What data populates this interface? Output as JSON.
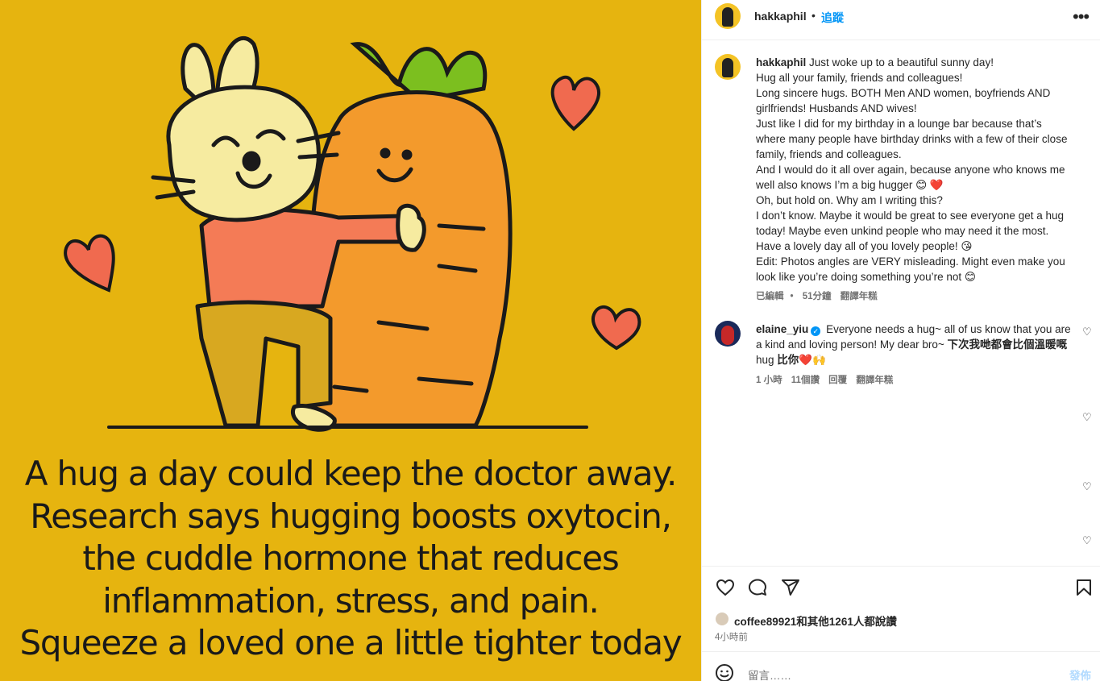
{
  "post_image": {
    "lines": [
      "A hug a day could keep the doctor away.",
      "Research says hugging boosts oxytocin,",
      "the cuddle hormone that reduces",
      "inflammation, stress, and pain.",
      "Squeeze a loved one a little tighter today"
    ],
    "background_color": "#e6b40f"
  },
  "header": {
    "username": "hakkaphil",
    "separator": "•",
    "follow_label": "追蹤",
    "more_icon": "more-horizontal-icon"
  },
  "caption": {
    "username": "hakkaphil",
    "lines": [
      "Just woke up to a beautiful sunny day!",
      "Hug all your family, friends and colleagues!",
      "Long sincere hugs. BOTH Men AND women, boyfriends AND",
      "girlfriends! Husbands AND wives!",
      "Just like I did for my birthday in a lounge bar because that’s",
      "where many people have birthday drinks with a few of their close",
      "family, friends and colleagues.",
      "And I would do it all over again, because anyone who knows me",
      "well also knows I’m a big hugger 😊 ❤️",
      "Oh, but hold on. Why am I writing this?",
      "I don’t know. Maybe it would be great to see everyone get a hug",
      "today! Maybe even unkind people who may need it the most.",
      "Have a lovely day all of you lovely people! 😘",
      "Edit: Photos angles are VERY misleading. Might even make you",
      "look like you’re doing something you’re not 😊"
    ],
    "edited_label": "已編輯",
    "dot": "•",
    "time": "51分鐘",
    "translate_label": "翻譯年糕"
  },
  "comment": {
    "username": "elaine_yiu",
    "text_plain": "Everyone needs a hug~ all of us know that you are a kind and loving person! My dear bro~ ",
    "text_bold_1": "下次我哋都會比個溫暖嘅",
    "text_mid": "hug",
    "text_bold_2": " 比你",
    "text_emoji": "❤️🙌",
    "time": "1 小時",
    "likes": "11個讚",
    "reply_label": "回覆",
    "translate_label": "翻譯年糕"
  },
  "actions": {
    "like_icon": "heart-icon",
    "comment_icon": "comment-icon",
    "share_icon": "send-icon",
    "save_icon": "bookmark-icon",
    "likes_text": "coffee89921和其他1261人都說讚",
    "time_ago": "4小時前"
  },
  "comment_box": {
    "placeholder": "留言……",
    "post_label": "發佈"
  }
}
